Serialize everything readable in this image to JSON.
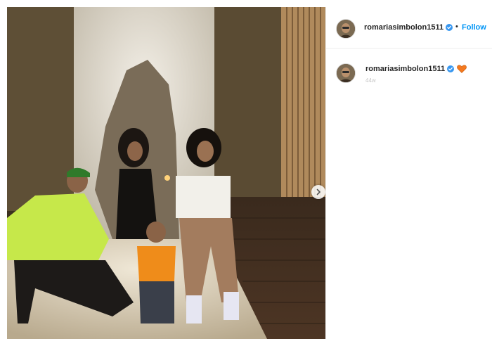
{
  "post": {
    "photo_alt": "",
    "next_button_icon": "chevron-right-icon"
  },
  "header": {
    "username": "romariasimbolon1511",
    "separator": "•",
    "follow_label": "Follow"
  },
  "caption": {
    "username": "romariasimbolon1511",
    "emoji": "orange-heart-icon",
    "meta_text": "44w"
  },
  "colors": {
    "follow_blue": "#0095f6",
    "verified_blue": "#3897f0",
    "heart_orange": "#f4791f",
    "username_text": "#262626"
  }
}
